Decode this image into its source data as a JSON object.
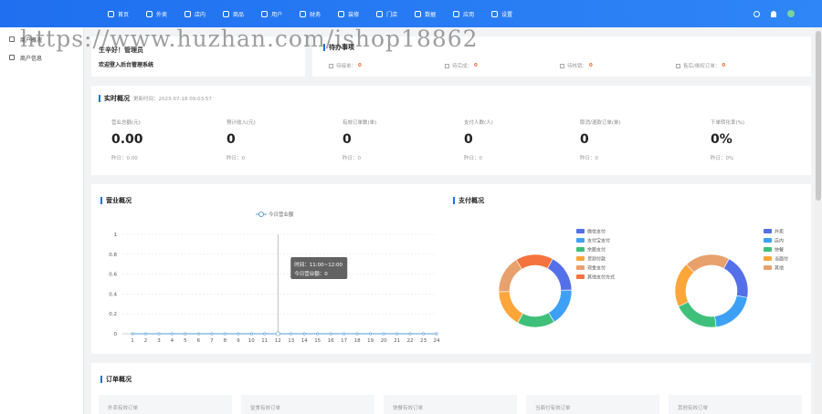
{
  "nav": {
    "items": [
      {
        "label": "首页",
        "icon": "home-icon"
      },
      {
        "label": "外卖",
        "icon": "scooter-icon"
      },
      {
        "label": "店内",
        "icon": "store-icon"
      },
      {
        "label": "商品",
        "icon": "goods-icon"
      },
      {
        "label": "用户",
        "icon": "user-icon"
      },
      {
        "label": "财务",
        "icon": "finance-icon"
      },
      {
        "label": "装修",
        "icon": "decorate-icon"
      },
      {
        "label": "门店",
        "icon": "shop-icon"
      },
      {
        "label": "数据",
        "icon": "data-icon"
      },
      {
        "label": "应用",
        "icon": "apps-icon"
      },
      {
        "label": "设置",
        "icon": "settings-icon"
      }
    ]
  },
  "sidebar": {
    "items": [
      {
        "label": "商户概况"
      },
      {
        "label": "商户信息"
      }
    ]
  },
  "welcome": {
    "hello": "生辛好！管理员",
    "message": "欢迎登入后台管理系统"
  },
  "todo": {
    "title": "待办事项",
    "items": [
      {
        "label": "待接单：",
        "value": "0"
      },
      {
        "label": "待完成：",
        "value": "0"
      },
      {
        "label": "待核销：",
        "value": "0"
      },
      {
        "label": "售后/维权订单：",
        "value": "0"
      }
    ]
  },
  "realtime": {
    "title": "实时概况",
    "updated": "更新时间：2023-07-18 09:03:57",
    "stats": [
      {
        "label": "营业总额(元)",
        "value": "0.00",
        "sub": "昨日：0.00"
      },
      {
        "label": "预计收入(元)",
        "value": "0",
        "sub": "昨日：0"
      },
      {
        "label": "有效订单数(单)",
        "value": "0",
        "sub": "昨日：0"
      },
      {
        "label": "支付人数(人)",
        "value": "0",
        "sub": "昨日：0"
      },
      {
        "label": "取消/退款订单(单)",
        "value": "0",
        "sub": "昨日：0"
      },
      {
        "label": "下单转化率(%)",
        "value": "0%",
        "sub": "昨日：0%"
      }
    ]
  },
  "business": {
    "title": "营业概况",
    "legend": "今日营业额",
    "tooltip_time": "时间：11:00~12:00",
    "tooltip_value": "今日营业额：0"
  },
  "payment": {
    "title": "支付概况",
    "legend1": [
      "微信支付",
      "支付宝支付",
      "余额支付",
      "货到付款",
      "现金支付",
      "其他支付方式"
    ],
    "legend2": [
      "外卖",
      "店内",
      "快餐",
      "当面付",
      "其他"
    ]
  },
  "orders": {
    "title": "订单概况",
    "boxes": [
      "外卖有效订单",
      "堂食有效订单",
      "快餐有效订单",
      "当面付有效订单",
      "其他有效订单"
    ]
  },
  "watermark": "https://www.huzhan.com/ishop18862",
  "chart_data": [
    {
      "type": "line",
      "legend": [
        "今日营业额"
      ],
      "x": [
        1,
        2,
        3,
        4,
        5,
        6,
        7,
        8,
        9,
        10,
        11,
        12,
        13,
        14,
        15,
        16,
        17,
        18,
        19,
        20,
        21,
        22,
        23,
        24
      ],
      "series": [
        {
          "name": "今日营业额",
          "values": [
            0,
            0,
            0,
            0,
            0,
            0,
            0,
            0,
            0,
            0,
            0,
            0,
            0,
            0,
            0,
            0,
            0,
            0,
            0,
            0,
            0,
            0,
            0,
            0
          ]
        }
      ],
      "yticks": [
        "0",
        "0.2",
        "0.4",
        "0.6",
        "0.8",
        "1"
      ],
      "ylim": [
        0,
        1
      ],
      "highlight_x": 12,
      "color": "#5b9bd5"
    },
    {
      "type": "pie",
      "categories": [
        "微信支付",
        "支付宝支付",
        "余额支付",
        "货到付款",
        "现金支付",
        "其他支付方式"
      ],
      "values": [
        1,
        1,
        1,
        1,
        1,
        1
      ],
      "colors": [
        "#5470e8",
        "#3ea0f5",
        "#3fc07a",
        "#fca63a",
        "#e8a06c",
        "#f5733e"
      ]
    },
    {
      "type": "pie",
      "categories": [
        "外卖",
        "店内",
        "快餐",
        "当面付",
        "其他"
      ],
      "values": [
        1,
        1,
        1,
        1,
        1
      ],
      "colors": [
        "#5470e8",
        "#3ea0f5",
        "#3fc07a",
        "#fca63a",
        "#e8a06c"
      ]
    }
  ]
}
